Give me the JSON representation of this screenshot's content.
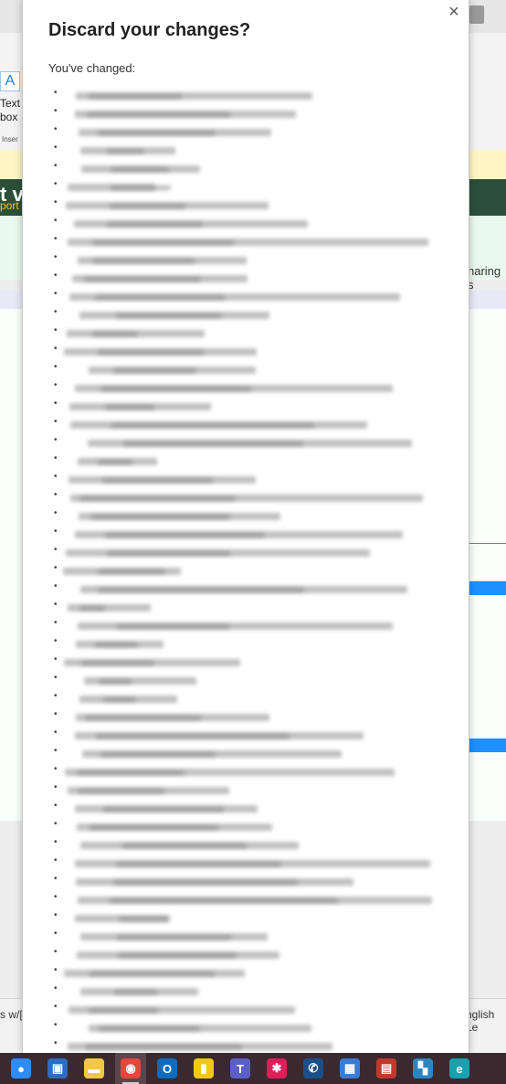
{
  "background_app": {
    "font_button_glyph": "A",
    "ribbon_text_box_label": "Text box",
    "ribbon_insert_label": "Inser",
    "banner_title": "t v",
    "banner_subtitle": "port",
    "sharing_text": "haring s",
    "status_left": "s w/[",
    "status_right": "nglish Le"
  },
  "dialog": {
    "title": "Discard your changes?",
    "intro": "You've changed:",
    "close_glyph": "×",
    "bullet_glyph": "•",
    "changed_items_count_visible": 53,
    "changed_items_note": "item text is blurred/redacted in the screenshot"
  },
  "taskbar": {
    "items": [
      {
        "icon": "zoom-icon",
        "color": "#2d8cff",
        "glyph": "●"
      },
      {
        "icon": "remote-desktop-icon",
        "color": "#2b6cc4",
        "glyph": "▣"
      },
      {
        "icon": "file-explorer-icon",
        "color": "#f2c744",
        "glyph": "▬"
      },
      {
        "icon": "chrome-icon",
        "color": "#e8453c",
        "glyph": "◉",
        "active": true
      },
      {
        "icon": "outlook-icon",
        "color": "#0f6cbd",
        "glyph": "O"
      },
      {
        "icon": "power-bi-icon",
        "color": "#f2c811",
        "glyph": "▮"
      },
      {
        "icon": "teams-icon",
        "color": "#5b5fc7",
        "glyph": "T"
      },
      {
        "icon": "slack-icon",
        "color": "#e01e5a",
        "glyph": "✱"
      },
      {
        "icon": "phone-icon",
        "color": "#1b4f8a",
        "glyph": "✆"
      },
      {
        "icon": "calculator-icon",
        "color": "#3a7bd5",
        "glyph": "▦"
      },
      {
        "icon": "snipping-tool-icon",
        "color": "#c0392b",
        "glyph": "▤"
      },
      {
        "icon": "network-app-icon",
        "color": "#2e86c1",
        "glyph": "▚"
      },
      {
        "icon": "edge-icon",
        "color": "#1aa1b0",
        "glyph": "e"
      }
    ]
  }
}
